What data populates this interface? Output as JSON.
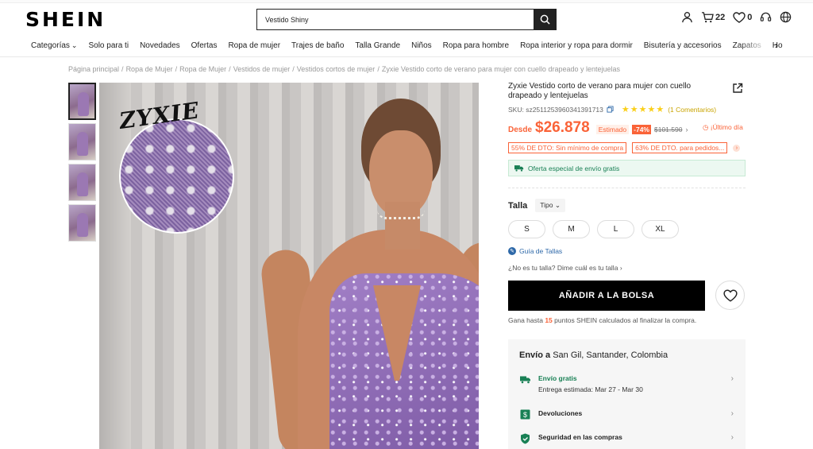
{
  "header": {
    "logo": "SHEIN",
    "search_value": "Vestido Shiny",
    "cart_count": "22",
    "wishlist_count": "0"
  },
  "nav": {
    "items": [
      "Categorías",
      "Solo para ti",
      "Novedades",
      "Ofertas",
      "Ropa de mujer",
      "Trajes de baño",
      "Talla Grande",
      "Niños",
      "Ropa para hombre",
      "Ropa interior y ropa para dormir",
      "Bisutería y accesorios",
      "Zapatos",
      "Ho"
    ]
  },
  "breadcrumb": [
    "Página principal",
    "Ropa de Mujer",
    "Ropa de Mujer",
    "Vestidos de mujer",
    "Vestidos cortos de mujer",
    "Zyxie Vestido corto de verano para mujer con cuello drapeado y lentejuelas"
  ],
  "gallery": {
    "thumb_count": 4,
    "brand_overlay": "ZYXIE"
  },
  "product": {
    "title": "Zyxie Vestido corto de verano para mujer con cuello drapeado y lentejuelas",
    "sku": "SKU: sz2511253960341391713",
    "stars": "★★★★★",
    "reviews": "(1 Comentarios)",
    "price_prefix": "Desde",
    "price": "$26.878",
    "estimated_label": "Estimado",
    "discount": "-74%",
    "old_price": "$101.590",
    "last_day": "¡Último día",
    "coupons": [
      "55% DE DTO: Sin mínimo de compra",
      "63% DE DTO. para pedidos..."
    ],
    "shipping_offer": "Oferta especial de envío gratis",
    "size_label": "Talla",
    "size_type": "Tipo",
    "sizes": [
      "S",
      "M",
      "L",
      "XL"
    ],
    "size_guide": "Guía de Tallas",
    "not_your_size": "¿No es tu talla? Dime cuál es tu talla",
    "add_to_bag": "AÑADIR A LA BOLSA",
    "points_before": "Gana hasta",
    "points_value": "15",
    "points_after": "puntos SHEIN calculados al finalizar la compra."
  },
  "shipping": {
    "title_bold": "Envío a",
    "destination": "San Gil, Santander, Colombia",
    "rows": [
      {
        "title": "Envío gratis",
        "subtitle": "Entrega estimada: Mar 27 - Mar 30"
      },
      {
        "title": "Devoluciones",
        "subtitle": ""
      },
      {
        "title": "Seguridad en las compras",
        "subtitle": ""
      }
    ]
  },
  "colors": {
    "accent": "#fa6338",
    "green": "#198055",
    "black": "#000000",
    "star": "#facf19"
  }
}
